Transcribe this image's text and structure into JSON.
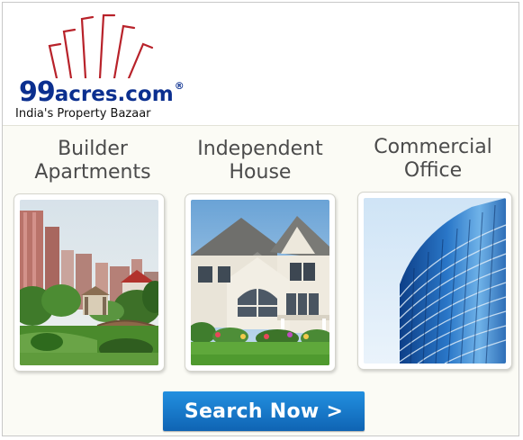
{
  "brand": {
    "name_number": "99",
    "name_word": "acres.com",
    "registered_mark": "®",
    "tagline": "India's Property Bazaar",
    "logo_color": "#0b2f8f",
    "accent_color": "#b8222a"
  },
  "categories": [
    {
      "line1": "Builder",
      "line2": "Apartments",
      "image": "apartment-complex-photo"
    },
    {
      "line1": "Independent",
      "line2": "House",
      "image": "independent-house-photo"
    },
    {
      "line1": "Commercial",
      "line2": "Office",
      "image": "office-tower-photo"
    }
  ],
  "cta": {
    "label": "Search Now >",
    "color": "#1a7ccf"
  }
}
